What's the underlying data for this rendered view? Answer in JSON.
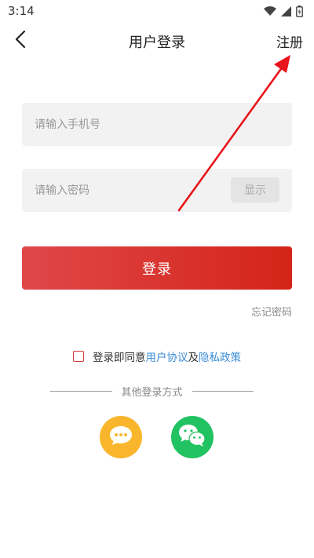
{
  "status_bar": {
    "time": "3:14",
    "icons": [
      "wifi-icon",
      "signal-icon",
      "battery-icon"
    ]
  },
  "header": {
    "title": "用户登录",
    "back_icon": "back-arrow-icon",
    "register_label": "注册"
  },
  "form": {
    "phone_placeholder": "请输入手机号",
    "phone_value": "",
    "password_placeholder": "请输入密码",
    "password_value": "",
    "show_label": "显示",
    "login_label": "登录",
    "forgot_label": "忘记密码"
  },
  "agreement": {
    "checked": false,
    "prefix": "登录即同意",
    "user_agreement": "用户协议",
    "conjunction": "及",
    "privacy_policy": "隐私政策"
  },
  "other_login": {
    "label": "其他登录方式",
    "methods": [
      {
        "name": "sms",
        "icon": "chat-bubble-icon",
        "color": "#f9b62c"
      },
      {
        "name": "wechat",
        "icon": "wechat-icon",
        "color": "#21c261"
      }
    ]
  },
  "colors": {
    "accent": "#d42418",
    "link": "#3b8bd6",
    "annotation": "#e8141b"
  }
}
